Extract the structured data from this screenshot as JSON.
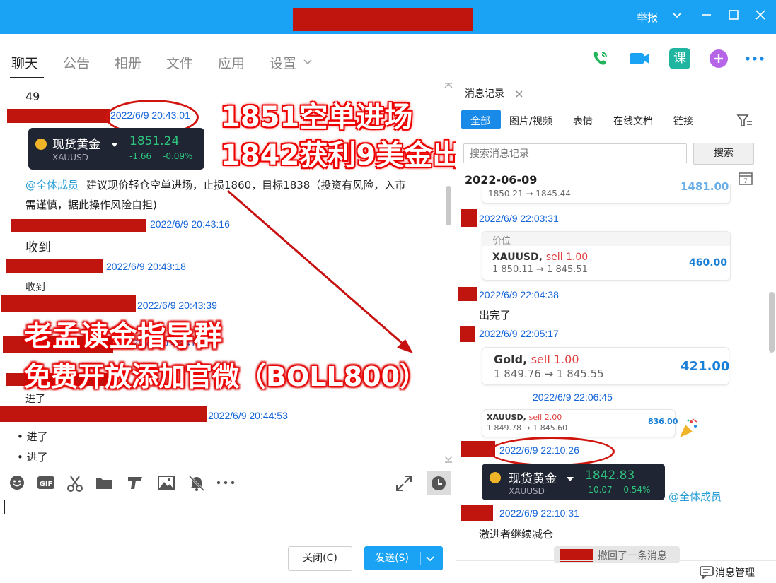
{
  "titlebar": {
    "report_label": "举报",
    "bg": "#1aa3f5"
  },
  "tabs": [
    {
      "label": "聊天"
    },
    {
      "label": "公告"
    },
    {
      "label": "相册"
    },
    {
      "label": "文件"
    },
    {
      "label": "应用"
    },
    {
      "label": "设置"
    }
  ],
  "top_icons": {
    "course_label": "课"
  },
  "chat": {
    "count_text": "49",
    "msg1_time": "2022/6/9 20:43:01",
    "card1": {
      "name": "现货黄金",
      "symbol": "XAUUSD",
      "price": "1851.24",
      "change": "-1.66",
      "change_pct": "-0.09%"
    },
    "mention": "@全体成员",
    "advice_line1": "建议现价轻仓空单进场，止损1860，目标1838（投资有风险，入市",
    "advice_line2": "需谨慎，据此操作风险自担)",
    "msg2_time": "2022/6/9 20:43:16",
    "msg2_text": "收到",
    "msg3_time": "2022/6/9 20:43:18",
    "msg3_text": "收到",
    "msg4_time": "2022/6/9 20:43:39",
    "msg5_time": "2022/6/9 20:43:41",
    "msg6_text": "进了",
    "msg7_time": "2022/6/9 20:44:53",
    "msg7_items": [
      "进了",
      "进了"
    ]
  },
  "overlay": {
    "line1": "1851空单进场",
    "line2": "1842获利9美金出局",
    "line3": "老孟读金指导群",
    "line4": "免费开放添加官微（BOLL800）"
  },
  "composer": {
    "close_label": "关闭(C)",
    "send_label": "发送(S)"
  },
  "right": {
    "tab_label": "消息记录",
    "filters": [
      "全部",
      "图片/视频",
      "表情",
      "在线文档",
      "链接"
    ],
    "search_placeholder": "搜索消息记录",
    "search_button": "搜索",
    "date_header": "2022-06-09",
    "card0_path": "1850.21 → 1845.44",
    "card0_val": "1481.00",
    "t1": "2022/6/9 22:03:31",
    "card1_head": "价位",
    "card1_sym": "XAUUSD,",
    "card1_sell": "sell 1.00",
    "card1_path": "1 850.11 → 1 845.51",
    "card1_val": "460.00",
    "t2": "2022/6/9 22:04:38",
    "m2": "出完了",
    "t3": "2022/6/9 22:05:17",
    "card2_sym": "Gold,",
    "card2_sell": "sell 1.00",
    "card2_path": "1 849.76 → 1 845.55",
    "card2_val": "421.00",
    "t4": "2022/6/9 22:06:45",
    "card3_sym": "XAUUSD,",
    "card3_sell": "sell 2.00",
    "card3_path": "1 849.78 → 1 845.60",
    "card3_val": "836.00",
    "t5": "2022/6/9 22:10:26",
    "card4": {
      "name": "现货黄金",
      "symbol": "XAUUSD",
      "price": "1842.83",
      "change": "-10.07",
      "change_pct": "-0.54%"
    },
    "mention": "@全体成员",
    "t6": "2022/6/9 22:10:31",
    "m6": "激进者继续减仓",
    "recall": "撤回了一条消息",
    "manage": "消息管理"
  }
}
